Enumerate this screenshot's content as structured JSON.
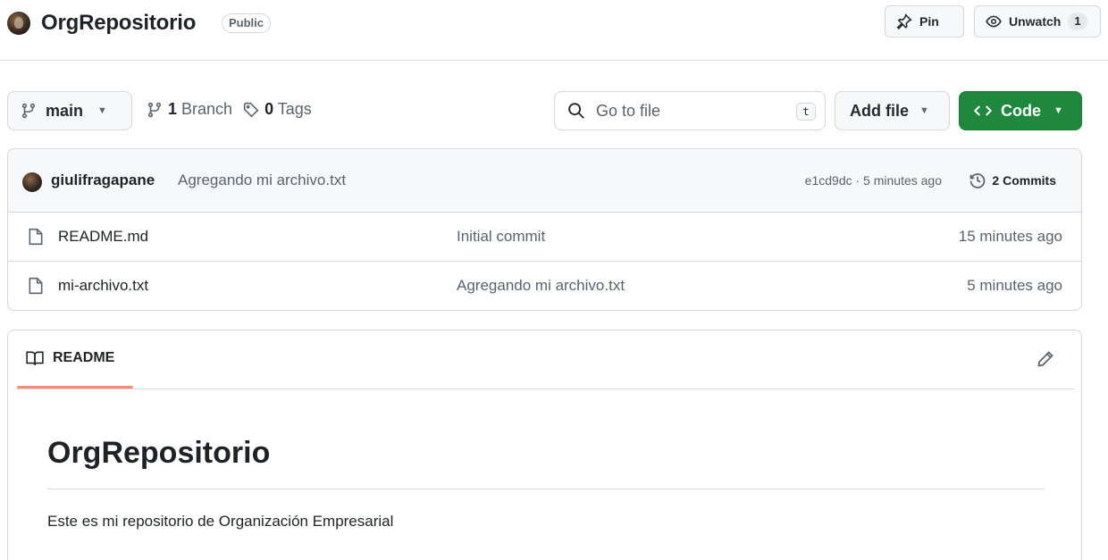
{
  "header": {
    "repo_name": "OrgRepositorio",
    "visibility": "Public",
    "pin_label": "Pin",
    "unwatch_label": "Unwatch",
    "watch_count": "1"
  },
  "toolbar": {
    "branch_name": "main",
    "branch_count": "1",
    "branch_word": "Branch",
    "tag_count": "0",
    "tag_word": "Tags",
    "search_placeholder": "Go to file",
    "search_shortcut": "t",
    "add_file_label": "Add file",
    "code_label": "Code"
  },
  "latest_commit": {
    "author": "giulifragapane",
    "message": "Agregando mi archivo.txt",
    "meta": "e1cd9dc · 5 minutes ago",
    "commits_label": "2 Commits"
  },
  "files": [
    {
      "name": "README.md",
      "commit": "Initial commit",
      "time": "15 minutes ago"
    },
    {
      "name": "mi-archivo.txt",
      "commit": "Agregando mi archivo.txt",
      "time": "5 minutes ago"
    }
  ],
  "readme": {
    "tab_label": "README",
    "title": "OrgRepositorio",
    "body": "Este es mi repositorio de Organización Empresarial"
  },
  "colors": {
    "code_button": "#1f883d",
    "tab_underline": "#fd8c73",
    "border": "#d0d7de"
  }
}
